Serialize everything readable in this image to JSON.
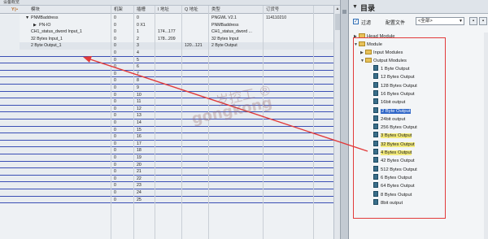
{
  "left_panel": {
    "topbar": "设备概览",
    "columns": {
      "module": "模块",
      "rack": "机架",
      "slot": "插槽",
      "i_addr": "I 地址",
      "q_addr": "Q 地址",
      "type": "类型",
      "order": "订货号"
    },
    "rows": [
      {
        "module": "PNMBaddress",
        "rack": "0",
        "slot": "0",
        "i_addr": "",
        "q_addr": "",
        "type": "PNGWL V2.1",
        "order": "114110210"
      },
      {
        "module": "PN-IO",
        "rack": "0",
        "slot": "0 X1",
        "i_addr": "",
        "q_addr": "",
        "type": "PNMBaddress",
        "order": ""
      },
      {
        "module": "CH1_status_dword Input_1",
        "rack": "0",
        "slot": "1",
        "i_addr": "174...177",
        "q_addr": "",
        "type": "CH1_status_dword ...",
        "order": ""
      },
      {
        "module": "32 Bytes Input_1",
        "rack": "0",
        "slot": "2",
        "i_addr": "178...209",
        "q_addr": "",
        "type": "32 Bytes Input",
        "order": ""
      },
      {
        "module": "2 Byte Output_1",
        "rack": "0",
        "slot": "3",
        "i_addr": "",
        "q_addr": "120...121",
        "type": "2 Byte Output",
        "order": ""
      }
    ],
    "empty_slots": [
      "4",
      "5",
      "6",
      "7",
      "8",
      "9",
      "10",
      "11",
      "12",
      "13",
      "14",
      "15",
      "16",
      "17",
      "18",
      "19",
      "20",
      "21",
      "22",
      "23",
      "24",
      "25"
    ],
    "empty_rack": "0"
  },
  "catalog": {
    "title": "目录",
    "filter_label": "过滤",
    "config_label": "配置文件",
    "config_value": "<全部>",
    "tree": {
      "head_module": "Head Module",
      "module": "Module",
      "input_modules": "Input Modules",
      "output_modules": "Output Modules",
      "items": [
        "1 Byte Output",
        "12 Bytes Output",
        "128 Bytes Output",
        "16 Bytes Output",
        "16bit output",
        "2 Byte Output",
        "24bit output",
        "256 Bytes Output",
        "3 Bytes Output",
        "32 Bytes Output",
        "4 Bytes Output",
        "42 Bytes Output",
        "512 Bytes Output",
        "6 Bytes Output",
        "64 Bytes Output",
        "8 Bytes Output",
        "8bit output"
      ],
      "selected": "2 Byte Output",
      "hover": [
        "3 Bytes Output",
        "32 Bytes Output",
        "4 Bytes Output"
      ]
    }
  },
  "watermark": {
    "line1": "岁控工 ®",
    "line2": "gongkong"
  },
  "colors": {
    "annotation_red": "#e23a3a",
    "selection_blue": "#2f66c8",
    "slot_line_blue": "#3b4fb5"
  }
}
